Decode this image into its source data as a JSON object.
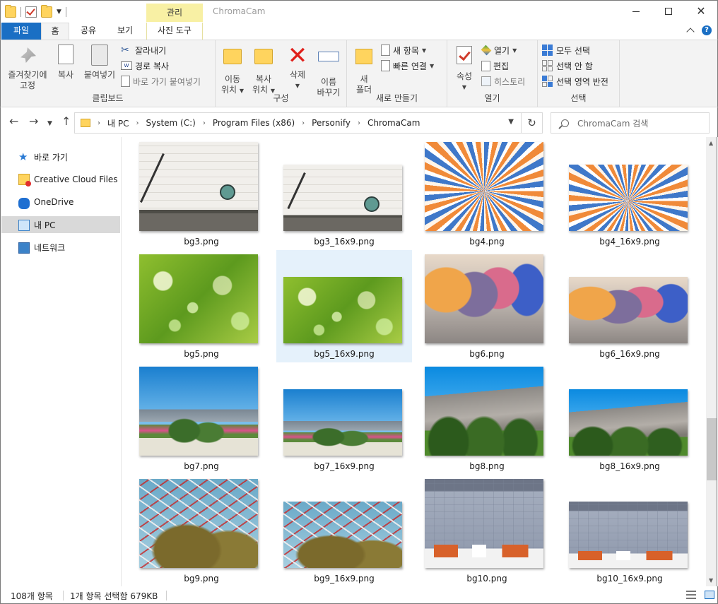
{
  "window": {
    "title": "ChromaCam",
    "context_tab_group": "관리"
  },
  "ribbon_tabs": {
    "file": "파일",
    "home": "홈",
    "share": "공유",
    "view": "보기",
    "picture_tools": "사진 도구"
  },
  "ribbon": {
    "clipboard": {
      "label": "클립보드",
      "pin_line1": "즐겨찾기에",
      "pin_line2": "고정",
      "copy": "복사",
      "paste": "붙여넣기",
      "cut": "잘라내기",
      "copy_path": "경로 복사",
      "paste_shortcut": "바로 가기 붙여넣기"
    },
    "organize": {
      "label": "구성",
      "move_to_line1": "이동",
      "move_to_line2": "위치",
      "copy_to_line1": "복사",
      "copy_to_line2": "위치",
      "delete": "삭제",
      "rename_line1": "이름",
      "rename_line2": "바꾸기"
    },
    "new": {
      "label": "새로 만들기",
      "new_folder_line1": "새",
      "new_folder_line2": "폴더",
      "new_item": "새 항목",
      "easy_access": "빠른 연결"
    },
    "open": {
      "label": "열기",
      "properties": "속성",
      "open": "열기",
      "edit": "편집",
      "history": "히스토리"
    },
    "select": {
      "label": "선택",
      "select_all": "모두 선택",
      "select_none": "선택 안 함",
      "invert": "선택 영역 반전"
    }
  },
  "address": {
    "segments": [
      "내 PC",
      "System (C:)",
      "Program Files (x86)",
      "Personify",
      "ChromaCam"
    ],
    "search_placeholder": "ChromaCam 검색"
  },
  "sidebar": {
    "items": [
      {
        "label": "바로 가기",
        "icon": "star-icon"
      },
      {
        "label": "Creative Cloud Files",
        "icon": "creative-cloud-folder-icon"
      },
      {
        "label": "OneDrive",
        "icon": "cloud-icon"
      },
      {
        "label": "내 PC",
        "icon": "computer-icon"
      },
      {
        "label": "네트워크",
        "icon": "network-icon"
      }
    ]
  },
  "files": [
    {
      "name": "bg3.png",
      "art": "wall",
      "wide": false
    },
    {
      "name": "bg3_16x9.png",
      "art": "wall",
      "wide": true
    },
    {
      "name": "bg4.png",
      "art": "burst",
      "wide": false
    },
    {
      "name": "bg4_16x9.png",
      "art": "burst",
      "wide": true
    },
    {
      "name": "bg5.png",
      "art": "bokeh",
      "wide": false
    },
    {
      "name": "bg5_16x9.png",
      "art": "bokeh",
      "wide": true,
      "selected": true
    },
    {
      "name": "bg6.png",
      "art": "bubbles",
      "wide": false
    },
    {
      "name": "bg6_16x9.png",
      "art": "bubbles",
      "wide": true
    },
    {
      "name": "bg7.png",
      "art": "palms",
      "wide": false
    },
    {
      "name": "bg7_16x9.png",
      "art": "palms",
      "wide": true
    },
    {
      "name": "bg8.png",
      "art": "mountain",
      "wide": false
    },
    {
      "name": "bg8_16x9.png",
      "art": "mountain",
      "wide": true
    },
    {
      "name": "bg9.png",
      "art": "ferris",
      "wide": false
    },
    {
      "name": "bg9_16x9.png",
      "art": "ferris",
      "wide": true
    },
    {
      "name": "bg10.png",
      "art": "room",
      "wide": false
    },
    {
      "name": "bg10_16x9.png",
      "art": "room",
      "wide": true
    }
  ],
  "status": {
    "item_count": "108개 항목",
    "selection": "1개 항목 선택함 679KB"
  },
  "colors": {
    "accent": "#1a6fc4",
    "selection_bg": "#e5f1fb",
    "context_tab": "#f8f0a4"
  }
}
